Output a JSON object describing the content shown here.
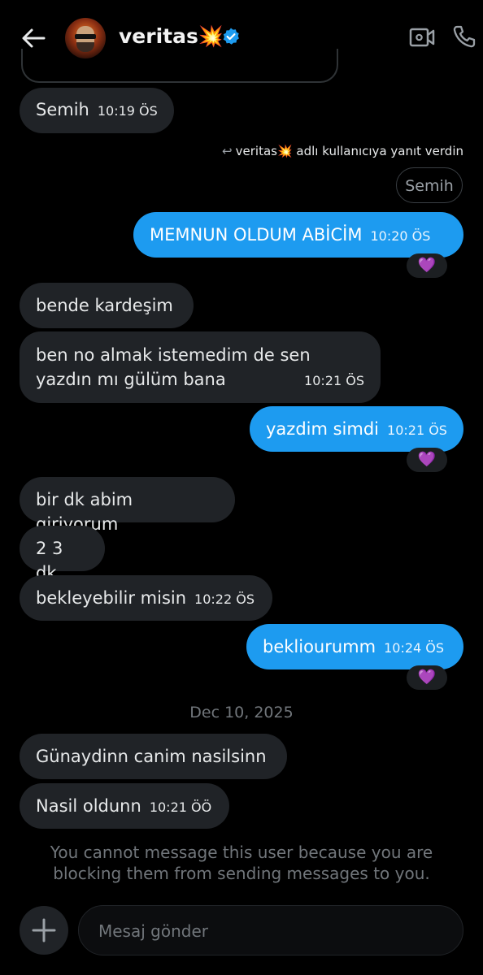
{
  "header": {
    "username": "veritas",
    "username_emoji": "💥",
    "verified_icon": "verified-badge-icon",
    "back_icon": "back-arrow-icon",
    "video_icon": "video-call-icon",
    "phone_icon": "phone-call-icon"
  },
  "messages": [
    {
      "from": "them",
      "text": "Semih",
      "time": "10:19 ÖS"
    },
    {
      "from": "me",
      "reply_note": "veritas💥 adlı kullanıcıya yanıt verdin",
      "quoted": "Semih",
      "text": "MEMNUN OLDUM ABİCİM",
      "time": "10:20 ÖS",
      "reaction": "💜"
    },
    {
      "from": "them",
      "text": "bende kardeşim"
    },
    {
      "from": "them",
      "text_line1": "ben  no almak istemedim de sen",
      "text_line2": "yazdın mı gülüm bana",
      "time": "10:21 ÖS"
    },
    {
      "from": "me",
      "text": "yazdim simdi",
      "time": "10:21 ÖS",
      "reaction": "💜"
    },
    {
      "from": "them",
      "text": "bir dk abim giriyorum"
    },
    {
      "from": "them",
      "text": "2 3 dk"
    },
    {
      "from": "them",
      "text": "bekleyebilir misin",
      "time": "10:22 ÖS"
    },
    {
      "from": "me",
      "text": "bekliourumm",
      "time": "10:24 ÖS",
      "reaction": "💜"
    },
    {
      "from": "them",
      "text": "Günaydinn canim nasilsinn"
    },
    {
      "from": "them",
      "text": "Nasil oldunn",
      "time": "10:21 ÖÖ"
    }
  ],
  "date_separator": "Dec 10, 2025",
  "blocked_notice": "You cannot message this user because you are blocking them from sending messages to you.",
  "composer": {
    "placeholder": "Mesaj gönder",
    "add_icon": "plus-icon"
  },
  "colors": {
    "background": "#000000",
    "incoming_bubble": "#202327",
    "outgoing_bubble": "#1d9bf0",
    "muted_text": "#71767b",
    "verified": "#1d9bf0"
  }
}
